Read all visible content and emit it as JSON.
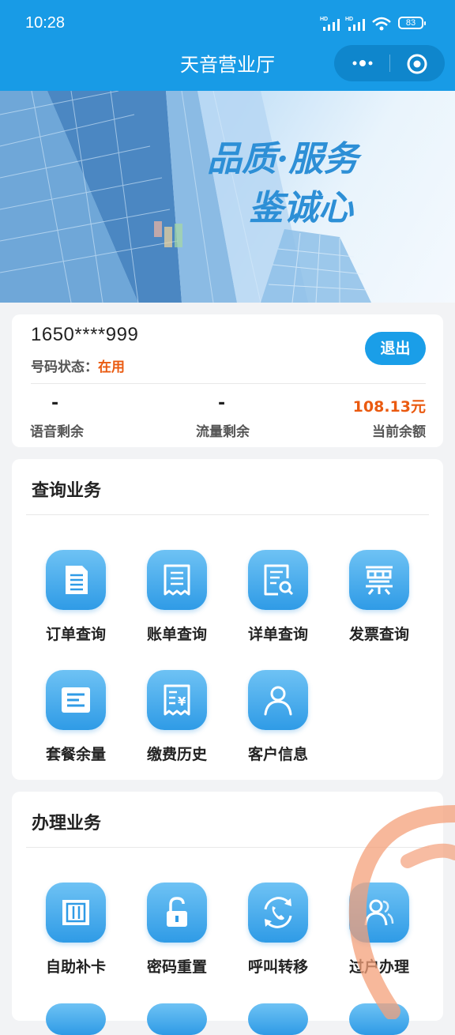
{
  "status_bar": {
    "time": "10:28",
    "battery": "83"
  },
  "header": {
    "title": "天音营业厅"
  },
  "banner": {
    "line1": "品质·服务",
    "line2": "鉴诚心"
  },
  "account": {
    "phone": "1650****999",
    "status_label": "号码状态：",
    "status_value": "在用",
    "logout_label": "退出",
    "stats": [
      {
        "value": "-",
        "label": "语音剩余"
      },
      {
        "value": "-",
        "label": "流量剩余"
      },
      {
        "value": "108.13元",
        "label": "当前余额"
      }
    ]
  },
  "query_section": {
    "title": "查询业务",
    "items": [
      {
        "label": "订单查询",
        "icon": "document-icon"
      },
      {
        "label": "账单查询",
        "icon": "receipt-icon"
      },
      {
        "label": "详单查询",
        "icon": "search-document-icon"
      },
      {
        "label": "发票查询",
        "icon": "invoice-icon"
      },
      {
        "label": "套餐余量",
        "icon": "package-icon"
      },
      {
        "label": "缴费历史",
        "icon": "payment-receipt-icon"
      },
      {
        "label": "客户信息",
        "icon": "user-icon"
      }
    ]
  },
  "handle_section": {
    "title": "办理业务",
    "items": [
      {
        "label": "自助补卡",
        "icon": "sim-card-icon"
      },
      {
        "label": "密码重置",
        "icon": "unlock-icon"
      },
      {
        "label": "呼叫转移",
        "icon": "call-forward-icon"
      },
      {
        "label": "过户办理",
        "icon": "transfer-user-icon"
      }
    ]
  },
  "colors": {
    "primary": "#189be6",
    "accent": "#ea5a10",
    "icon_gradient_top": "#6ec2f4",
    "icon_gradient_bottom": "#2f9be6"
  }
}
